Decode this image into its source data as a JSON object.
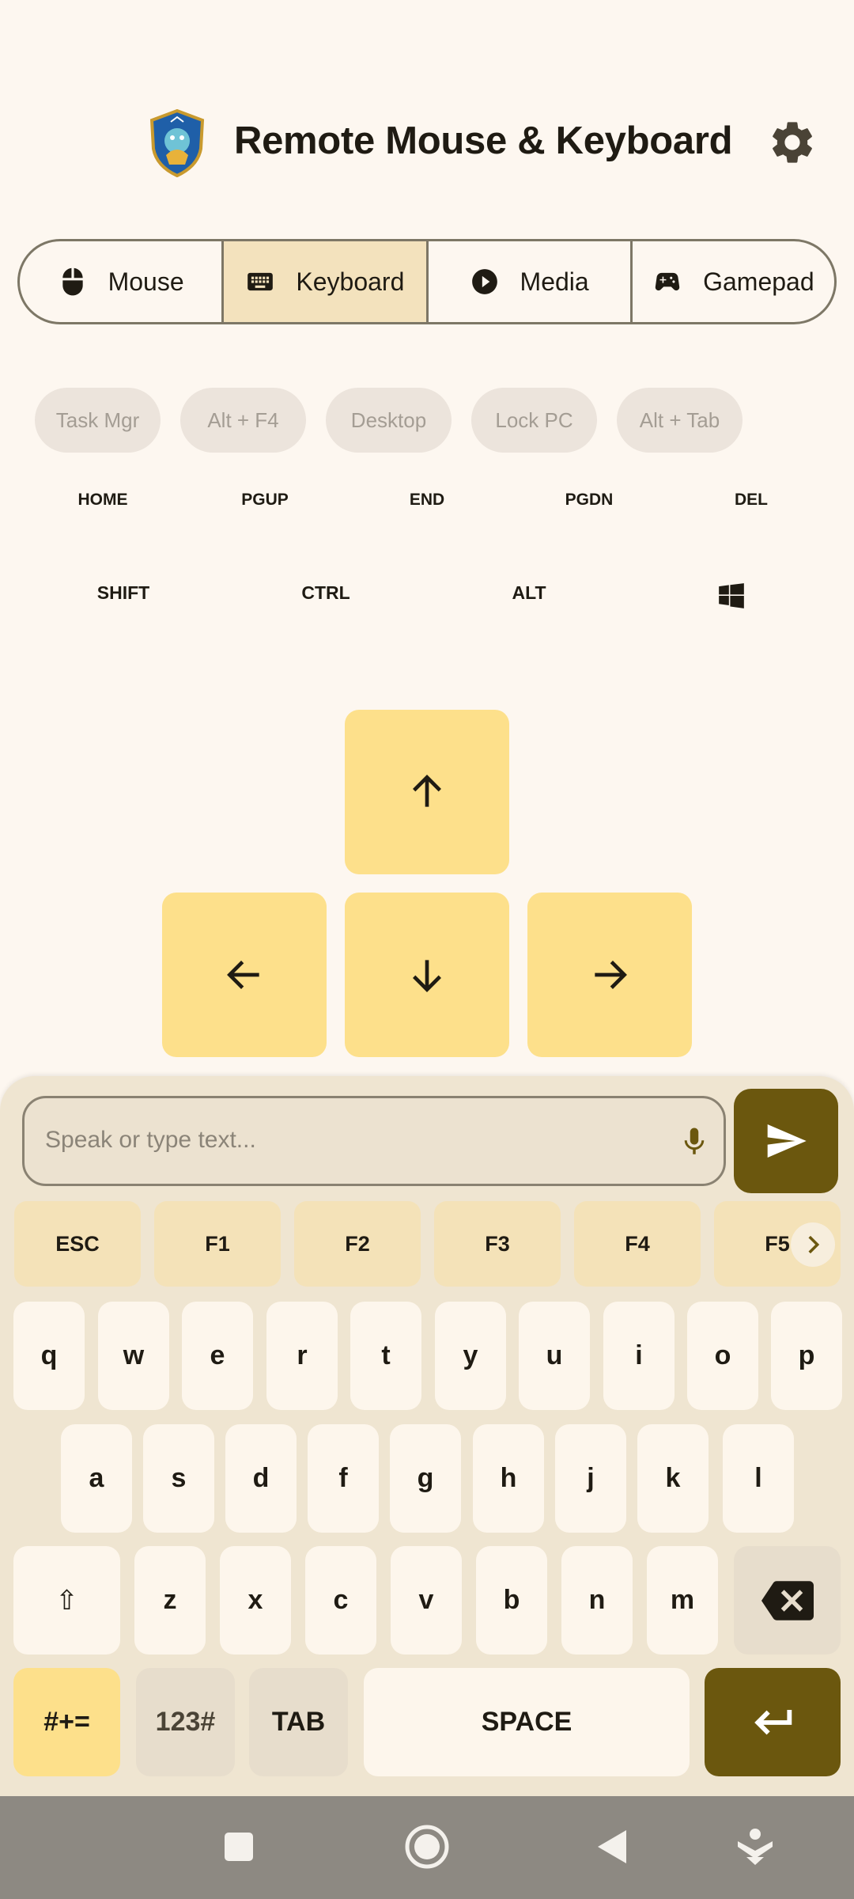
{
  "header": {
    "title": "Remote Mouse & Keyboard"
  },
  "tabs": [
    {
      "label": "Mouse",
      "icon": "mouse-icon",
      "active": false
    },
    {
      "label": "Keyboard",
      "icon": "keyboard-icon",
      "active": true
    },
    {
      "label": "Media",
      "icon": "play-circle-icon",
      "active": false
    },
    {
      "label": "Gamepad",
      "icon": "gamepad-icon",
      "active": false
    }
  ],
  "shortcuts": [
    "Task Mgr",
    "Alt + F4",
    "Desktop",
    "Lock PC",
    "Alt + Tab"
  ],
  "nav_keys": [
    "HOME",
    "PGUP",
    "END",
    "PGDN",
    "DEL"
  ],
  "modifier_keys": [
    "SHIFT",
    "CTRL",
    "ALT"
  ],
  "text_input": {
    "placeholder": "Speak or type text..."
  },
  "function_keys": [
    "ESC",
    "F1",
    "F2",
    "F3",
    "F4",
    "F5"
  ],
  "keyboard": {
    "row1": [
      "q",
      "w",
      "e",
      "r",
      "t",
      "y",
      "u",
      "i",
      "o",
      "p"
    ],
    "row2": [
      "a",
      "s",
      "d",
      "f",
      "g",
      "h",
      "j",
      "k",
      "l"
    ],
    "row3": [
      "z",
      "x",
      "c",
      "v",
      "b",
      "n",
      "m"
    ],
    "shift_label": "⇧",
    "symbols_label": "#+=",
    "numbers_label": "123#",
    "tab_label": "TAB",
    "space_label": "SPACE"
  },
  "colors": {
    "accent": "#6b570e",
    "arrow_key": "#fde08b",
    "active_tab": "#f3e2bd",
    "background": "#fdf7f0"
  }
}
